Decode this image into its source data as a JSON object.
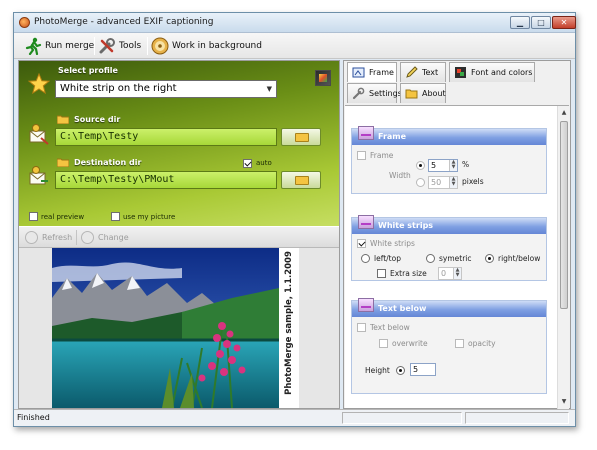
{
  "window": {
    "title": "PhotoMerge - advanced EXIF captioning",
    "minimize_glyph": "▁",
    "maximize_glyph": "□",
    "close_glyph": "✕"
  },
  "toolbar": {
    "run_merge": "Run merge",
    "tools": "Tools",
    "work_in_background": "Work in background"
  },
  "profile": {
    "label": "Select profile",
    "value": "White strip on the right"
  },
  "source": {
    "label": "Source dir",
    "value": "C:\\Temp\\Testy"
  },
  "destination": {
    "label": "Destination dir",
    "value": "C:\\Temp\\Testy\\PMout",
    "auto_label": "auto",
    "auto_checked": true
  },
  "options": {
    "real_preview": "real preview",
    "use_my_picture": "use my picture"
  },
  "left_toolbar": {
    "refresh": "Refresh",
    "change": "Change"
  },
  "preview": {
    "caption": "PhotoMerge sample, 1.1.2009"
  },
  "tabs": [
    {
      "label": "Frame",
      "selected": true
    },
    {
      "label": "Text",
      "selected": false
    },
    {
      "label": "Font and colors",
      "selected": false
    },
    {
      "label": "Settings",
      "selected": false
    },
    {
      "label": "About",
      "selected": false
    }
  ],
  "frame_group": {
    "title": "Frame",
    "frame_checkbox": "Frame",
    "width_label": "Width",
    "width_value": "5",
    "percent_label": "%",
    "pixels_value": "50",
    "pixels_label": "pixels"
  },
  "white_strips_group": {
    "title": "White strips",
    "white_strips_checkbox": "White strips",
    "left_top": "left/top",
    "symetric": "symetric",
    "right_below": "right/below",
    "extra_size": "Extra size",
    "extra_value": "0"
  },
  "text_below_group": {
    "title": "Text below",
    "text_below_checkbox": "Text below",
    "overwrite": "overwrite",
    "opacity": "opacity",
    "height_label": "Height",
    "height_value": "5"
  },
  "status": {
    "text": "Finished"
  }
}
